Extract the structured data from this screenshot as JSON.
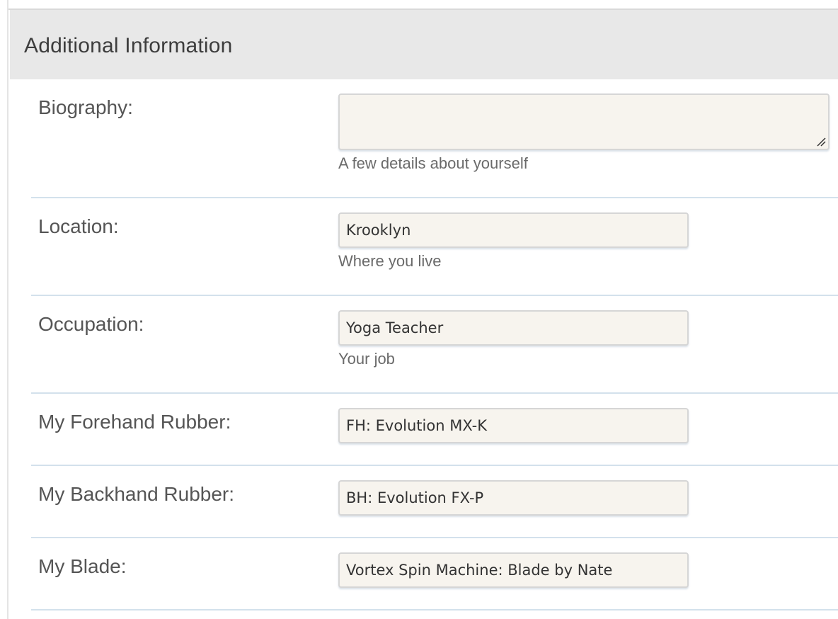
{
  "section": {
    "title": "Additional Information"
  },
  "fields": {
    "biography": {
      "label": "Biography:",
      "value": "",
      "hint": "A few details about yourself"
    },
    "location": {
      "label": "Location:",
      "value": "Krooklyn",
      "hint": "Where you live"
    },
    "occupation": {
      "label": "Occupation:",
      "value": "Yoga Teacher",
      "hint": "Your job"
    },
    "forehand_rubber": {
      "label": "My Forehand Rubber:",
      "value": "FH: Evolution MX-K"
    },
    "backhand_rubber": {
      "label": "My Backhand Rubber:",
      "value": "BH: Evolution FX-P"
    },
    "blade": {
      "label": "My Blade:",
      "value": "Vortex Spin Machine: Blade by Nate"
    }
  },
  "colors": {
    "header_bg": "#e8e8e8",
    "input_bg": "#f7f4ee",
    "row_divider": "#d3e1ec"
  }
}
